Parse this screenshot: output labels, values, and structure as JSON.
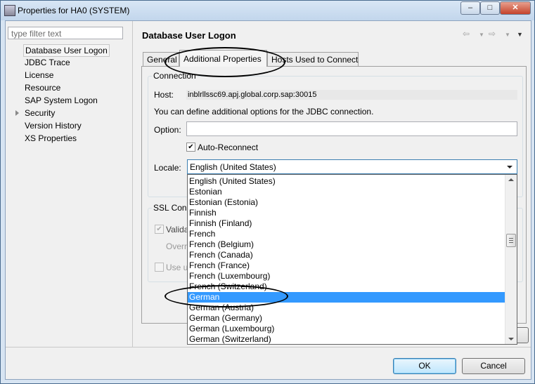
{
  "window": {
    "title": "Properties for HA0 (SYSTEM)",
    "minimize": "–",
    "maximize": "□",
    "close": "✕"
  },
  "sidebar": {
    "filter_placeholder": "type filter text",
    "items": [
      {
        "label": "Database User Logon",
        "selected": true
      },
      {
        "label": "JDBC Trace"
      },
      {
        "label": "License"
      },
      {
        "label": "Resource"
      },
      {
        "label": "SAP System Logon"
      },
      {
        "label": "Security",
        "expandable": true
      },
      {
        "label": "Version History"
      },
      {
        "label": "XS Properties"
      }
    ]
  },
  "page": {
    "title": "Database User Logon",
    "tabs": [
      {
        "label": "General"
      },
      {
        "label": "Additional Properties",
        "active": true
      },
      {
        "label": "Hosts Used to Connect"
      }
    ]
  },
  "connection": {
    "group_label": "Connection",
    "host_label": "Host:",
    "host_value": "inblrllssc69.apj.global.corp.sap:30015",
    "info_text": "You can define additional options for the JDBC connection.",
    "option_label": "Option:",
    "option_value": "",
    "auto_reconnect_label": "Auto-Reconnect",
    "auto_reconnect_checked": true,
    "locale_label": "Locale:",
    "locale_selected": "English (United States)"
  },
  "ssl": {
    "group_label": "SSL Conn",
    "validate_label": "Valida",
    "override_label": "Overr",
    "use_label": "Use u"
  },
  "locale_options": [
    "English (United States)",
    "Estonian",
    "Estonian (Estonia)",
    "Finnish",
    "Finnish (Finland)",
    "French",
    "French (Belgium)",
    "French (Canada)",
    "French (France)",
    "French (Luxembourg)",
    "French (Switzerland)",
    "German",
    "German (Austria)",
    "German (Germany)",
    "German (Luxembourg)",
    "German (Switzerland)"
  ],
  "highlighted_option": "German",
  "buttons": {
    "ok": "OK",
    "cancel": "Cancel"
  },
  "colors": {
    "selection": "#3399ff",
    "title_bar": "#c2d6ec",
    "close_button": "#c5432b"
  }
}
